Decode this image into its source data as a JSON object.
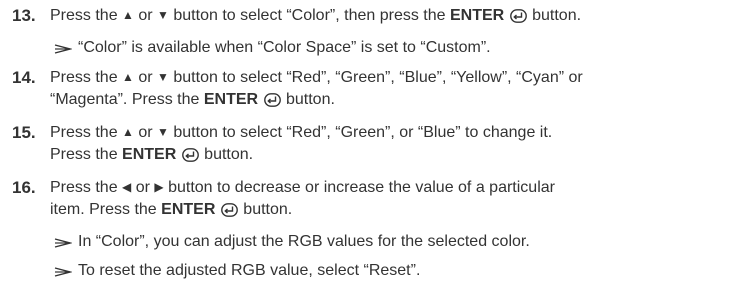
{
  "steps": [
    {
      "number": "13.",
      "lines": [
        {
          "parts": [
            {
              "t": "Press the "
            },
            {
              "icon": "up"
            },
            {
              "t": " or "
            },
            {
              "icon": "down"
            },
            {
              "t": " button to select “Color”, then press the "
            },
            {
              "b": "ENTER"
            },
            {
              "t": " "
            },
            {
              "icon": "enter"
            },
            {
              "t": " button."
            }
          ]
        }
      ],
      "notes": [
        "“Color” is available when “Color Space” is set to “Custom”."
      ]
    },
    {
      "number": "14.",
      "lines": [
        {
          "parts": [
            {
              "t": "Press the "
            },
            {
              "icon": "up"
            },
            {
              "t": " or "
            },
            {
              "icon": "down"
            },
            {
              "t": " button to select “Red”, “Green”, “Blue”, “Yellow”, “Cyan” or"
            }
          ]
        },
        {
          "parts": [
            {
              "t": "“Magenta”. Press the "
            },
            {
              "b": "ENTER"
            },
            {
              "t": " "
            },
            {
              "icon": "enter"
            },
            {
              "t": " button."
            }
          ]
        }
      ],
      "notes": []
    },
    {
      "number": "15.",
      "lines": [
        {
          "parts": [
            {
              "t": "Press the "
            },
            {
              "icon": "up"
            },
            {
              "t": " or "
            },
            {
              "icon": "down"
            },
            {
              "t": " button to select “Red”, “Green”, or “Blue” to change it."
            }
          ]
        },
        {
          "parts": [
            {
              "t": "Press the "
            },
            {
              "b": "ENTER"
            },
            {
              "t": " "
            },
            {
              "icon": "enter"
            },
            {
              "t": " button."
            }
          ]
        }
      ],
      "notes": []
    },
    {
      "number": "16.",
      "lines": [
        {
          "parts": [
            {
              "t": "Press the "
            },
            {
              "icon": "left"
            },
            {
              "t": " or "
            },
            {
              "icon": "right"
            },
            {
              "t": " button to decrease or increase the value of a particular"
            }
          ]
        },
        {
          "parts": [
            {
              "t": "item. Press the "
            },
            {
              "b": "ENTER"
            },
            {
              "t": " "
            },
            {
              "icon": "enter"
            },
            {
              "t": " button."
            }
          ]
        }
      ],
      "notes": [
        "In “Color”, you can adjust the RGB values for the selected color.",
        "To reset the adjusted RGB value, select “Reset”."
      ]
    }
  ],
  "icons": {
    "up": "up-triangle-icon",
    "down": "down-triangle-icon",
    "left": "left-triangle-icon",
    "right": "right-triangle-icon",
    "enter": "enter-icon",
    "note": "note-arrow-icon"
  }
}
